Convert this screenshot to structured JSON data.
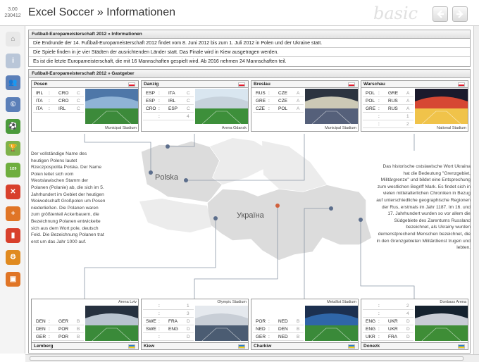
{
  "header": {
    "version_line1": "3.00",
    "version_line2": "230412",
    "title": "Excel Soccer » Informationen",
    "brand": "basic",
    "back_icon": "arrow-left-icon",
    "forward_icon": "arrow-right-icon"
  },
  "sidebar": [
    {
      "icon": "home-icon",
      "color": "#e8e8e8"
    },
    {
      "icon": "info-icon",
      "color": "#b9c6d8"
    },
    {
      "icon": "teams-icon",
      "color": "#5b7fb8"
    },
    {
      "icon": "copyright-icon",
      "color": "#5b7fb8"
    },
    {
      "icon": "ball-icon",
      "color": "#4b9a3b"
    },
    {
      "icon": "trophy-icon",
      "color": "#7fb24a"
    },
    {
      "icon": "numbers-icon",
      "color": "#6fae3e"
    },
    {
      "icon": "bracket-icon",
      "color": "#d8402c"
    },
    {
      "icon": "add-team-icon",
      "color": "#e07526"
    },
    {
      "icon": "statistics-icon",
      "color": "#d8402c"
    },
    {
      "icon": "settings-icon",
      "color": "#e08a1f"
    },
    {
      "icon": "window-icon",
      "color": "#e07526"
    }
  ],
  "info_panel": {
    "title": "Fußball-Europameisterschaft 2012 » Informationen",
    "rows": [
      "Die Endrunde der 14. Fußball-Europameisterschaft 2012 findet vom 8. Juni 2012 bis zum 1. Juli 2012 in Polen und der Ukraine statt.",
      "Die Spiele finden in je vier Städten der ausrichtenden Länder statt. Das Finale wird in Kiew ausgetragen werden.",
      "Es ist die letzte Europameisterschaft, die mit 16 Mannschaften gespielt wird. Ab 2016 nehmen 24 Mannschaften teil."
    ]
  },
  "hosts_panel": {
    "title": "Fußball-Europameisterschaft 2012 » Gastgeber"
  },
  "cities": [
    {
      "name": "Posen",
      "country": "pl",
      "stadium": "Municipal Stadium",
      "matches": [
        [
          "IRL",
          ":",
          "CRO",
          "C"
        ],
        [
          "ITA",
          ":",
          "CRO",
          "C"
        ],
        [
          "ITA",
          ":",
          "IRL",
          "C"
        ]
      ],
      "colors": [
        "#4e77a8",
        "#8fb3d6",
        "#3c8a3a"
      ]
    },
    {
      "name": "Danzig",
      "country": "pl",
      "stadium": "Arena Gdansk",
      "matches": [
        [
          "ESP",
          ":",
          "ITA",
          "C"
        ],
        [
          "ESP",
          ":",
          "IRL",
          "C"
        ],
        [
          "CRO",
          ":",
          "ESP",
          "C"
        ],
        [
          "",
          ":",
          "",
          "4"
        ]
      ],
      "colors": [
        "#d9e6f0",
        "#c7d2dc",
        "#3d8f3a"
      ]
    },
    {
      "name": "Breslau",
      "country": "pl",
      "stadium": "Municipal Stadium",
      "matches": [
        [
          "RUS",
          ":",
          "CZE",
          "A"
        ],
        [
          "GRE",
          ":",
          "CZE",
          "A"
        ],
        [
          "CZE",
          ":",
          "POL",
          "A"
        ]
      ],
      "colors": [
        "#2c3440",
        "#ccc9b6",
        "#55607a"
      ]
    },
    {
      "name": "Warschau",
      "country": "pl",
      "stadium": "National Stadium",
      "matches": [
        [
          "POL",
          ":",
          "GRE",
          "A"
        ],
        [
          "POL",
          ":",
          "RUS",
          "A"
        ],
        [
          "GRE",
          ":",
          "RUS",
          "A"
        ],
        [
          "",
          ":",
          "",
          "1"
        ],
        [
          "",
          ":",
          "",
          "2"
        ]
      ],
      "colors": [
        "#1b1a2c",
        "#d64733",
        "#f0c34a"
      ]
    },
    {
      "name": "Lemberg",
      "country": "ua",
      "stadium": "Arena Lviv",
      "matches": [
        [
          "DEN",
          ":",
          "GER",
          "B"
        ],
        [
          "DEN",
          ":",
          "POR",
          "B"
        ],
        [
          "GER",
          ":",
          "POR",
          "B"
        ]
      ],
      "colors": [
        "#26313f",
        "#b8c3cf",
        "#3a8a39"
      ]
    },
    {
      "name": "Kiew",
      "country": "ua",
      "stadium": "Olympic Stadium",
      "matches": [
        [
          "",
          ":",
          "",
          "1"
        ],
        [
          "",
          ":",
          "",
          "3"
        ],
        [
          "SWE",
          ":",
          "FRA",
          "D"
        ],
        [
          "SWE",
          ":",
          "ENG",
          "D"
        ],
        [
          "",
          ":",
          "",
          "D"
        ]
      ],
      "colors": [
        "#e5e9ee",
        "#c8ced6",
        "#4b5c72"
      ]
    },
    {
      "name": "Charkiw",
      "country": "ua",
      "stadium": "Metallist Stadium",
      "matches": [
        [
          "POR",
          ":",
          "NED",
          "B"
        ],
        [
          "NED",
          ":",
          "DEN",
          "B"
        ],
        [
          "GER",
          ":",
          "NED",
          "B"
        ]
      ],
      "colors": [
        "#1c3050",
        "#2f66a8",
        "#3a8a39"
      ]
    },
    {
      "name": "Donezk",
      "country": "ua",
      "stadium": "Donbass Arena",
      "matches": [
        [
          "",
          ":",
          "",
          "2"
        ],
        [
          "",
          ":",
          "",
          "4"
        ],
        [
          "ENG",
          ":",
          "UKR",
          "D"
        ],
        [
          "ENG",
          ":",
          "UKR",
          "D"
        ],
        [
          "UKR",
          ":",
          "FRA",
          "D"
        ]
      ],
      "colors": [
        "#15222f",
        "#c8ccd5",
        "#3e8d36"
      ]
    }
  ],
  "map": {
    "poland_label": "Polska",
    "ukraine_label": "Україна"
  },
  "text_left": "Der vollständige Name des heutigen Polens lautet Rzeczpospolita Polska. Der Name Polen leitet sich vom Westslawischen Stamm der Polanen (Polanie) ab, die sich im 5. Jahrhundert im Gebiet der heutigen Woiwodschaft Großpolen um Posen niederließen. Die Polanen waren zum größtenteil Ackerbauern, die Bezeichnung Polanen entwickelte sich aus dem Wort pole, deutsch Feld. Die Bezeichnung Polanen trat erst um das Jahr 1000 auf.",
  "text_right": "Das historische ostslawische Wort Ukraina hat die Bedeutung \"Grenzgebiet, Militärgrenze\" und bildet eine Entsprechung zum westlichen Begriff Mark. Es findet sich in vielen mittelalterlichen Chroniken in Bezug auf unterschiedliche geographische Regionen der Rus, erstmals im Jahr 1187. Im 16. und 17. Jahrhundert wurden so vor allem die Südgebiete des Zarentums Russland bezeichnet, als Ukrainy wurden demenstprechend Menschen bezeichnet, die in den Grenzgebieten Militärdienst trugen und lebten."
}
